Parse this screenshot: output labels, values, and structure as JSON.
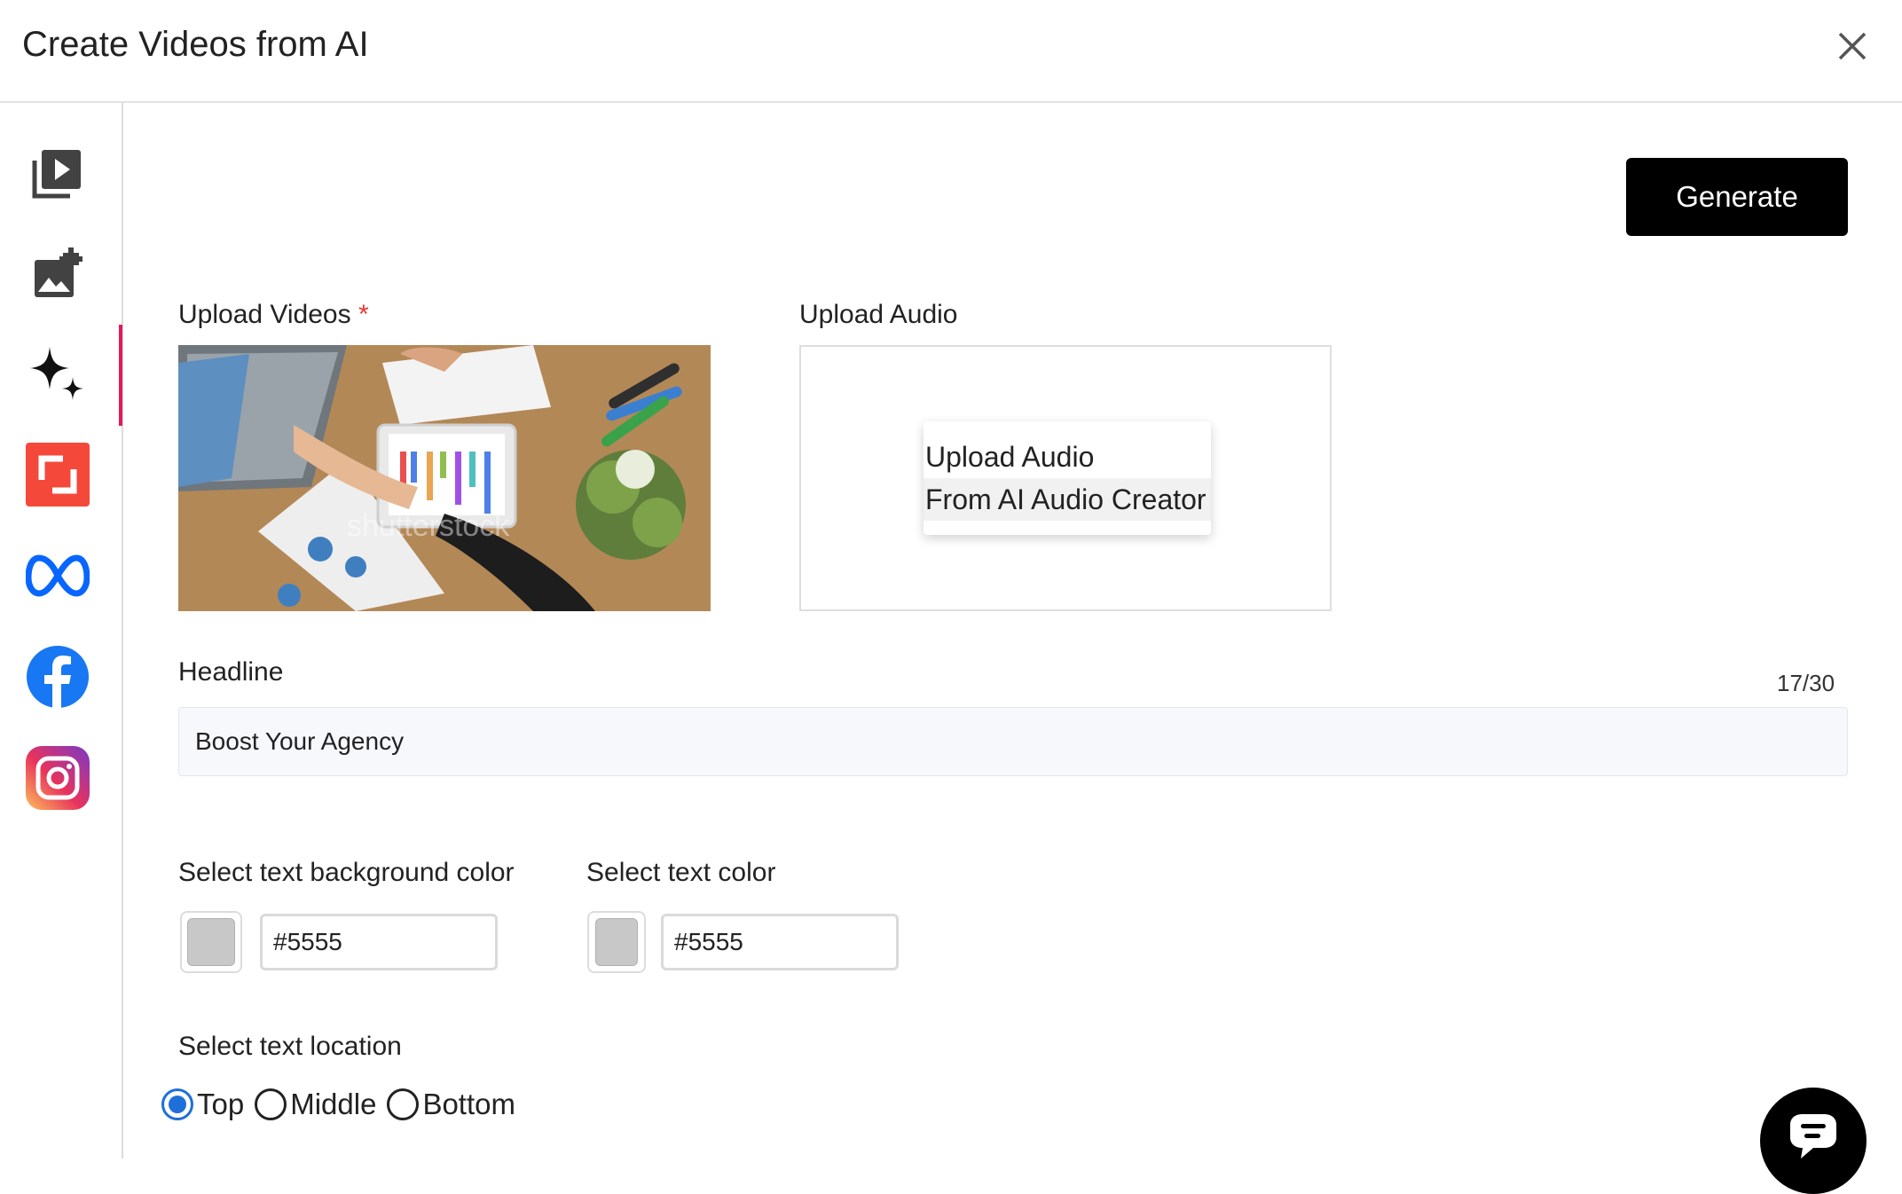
{
  "header": {
    "title": "Create Videos from AI",
    "close_icon": "close-icon"
  },
  "sidebar": {
    "items": [
      {
        "icon": "video-library-icon",
        "active": false
      },
      {
        "icon": "add-image-icon",
        "active": false
      },
      {
        "icon": "ai-sparkle-icon",
        "active": true
      },
      {
        "icon": "resize-frame-icon",
        "active": false,
        "color": "#f4493a"
      },
      {
        "icon": "meta-icon",
        "active": false,
        "color": "#0866ff"
      },
      {
        "icon": "facebook-icon",
        "active": false,
        "color": "#1877f2"
      },
      {
        "icon": "instagram-icon",
        "active": false
      }
    ],
    "active_indicator_color": "#e5195a"
  },
  "toolbar": {
    "generate_label": "Generate"
  },
  "upload_videos": {
    "label": "Upload Videos",
    "required_mark": "*",
    "thumbnail_watermark": "shutterstock"
  },
  "upload_audio": {
    "label": "Upload Audio",
    "options": [
      "Upload Audio",
      "From AI Audio Creator"
    ]
  },
  "headline": {
    "label": "Headline",
    "value": "Boost Your Agency",
    "counter": "17/30"
  },
  "text_bg_color": {
    "label": "Select text background color",
    "value": "#5555",
    "swatch": "#c8c8c8"
  },
  "text_color": {
    "label": "Select text color",
    "value": "#5555",
    "swatch": "#c8c8c8"
  },
  "text_location": {
    "label": "Select text location",
    "options": [
      "Top",
      "Middle",
      "Bottom"
    ],
    "selected": "Top"
  },
  "chat": {
    "icon": "chat-bubble-icon"
  }
}
